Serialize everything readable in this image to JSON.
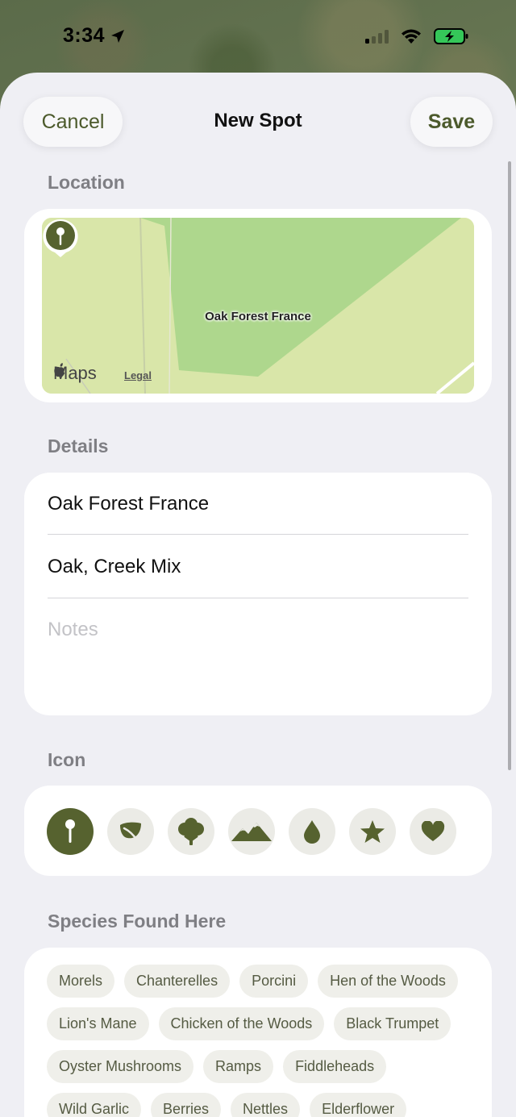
{
  "status_bar": {
    "time": "3:34"
  },
  "header": {
    "title": "New Spot",
    "cancel_label": "Cancel",
    "save_label": "Save"
  },
  "location": {
    "section_label": "Location",
    "map_pin_label": "Oak Forest France",
    "maps_brand": "Maps",
    "legal_label": "Legal"
  },
  "details": {
    "section_label": "Details",
    "name_value": "Oak Forest France",
    "habitat_value": "Oak, Creek Mix",
    "notes_placeholder": "Notes"
  },
  "icon_picker": {
    "section_label": "Icon",
    "icons": [
      "pin-icon",
      "leaf-icon",
      "tree-icon",
      "mountains-icon",
      "drop-icon",
      "star-icon",
      "heart-icon"
    ],
    "selected": "pin-icon"
  },
  "species": {
    "section_label": "Species Found Here",
    "chips": [
      "Morels",
      "Chanterelles",
      "Porcini",
      "Hen of the Woods",
      "Lion's Mane",
      "Chicken of the Woods",
      "Black Trumpet",
      "Oyster Mushrooms",
      "Ramps",
      "Fiddleheads",
      "Wild Garlic",
      "Berries",
      "Nettles",
      "Elderflower"
    ]
  },
  "colors": {
    "accent": "#56622f",
    "sheet_bg": "#efeff4",
    "map_light": "#d9e6a9",
    "map_dark": "#a9d68a"
  }
}
